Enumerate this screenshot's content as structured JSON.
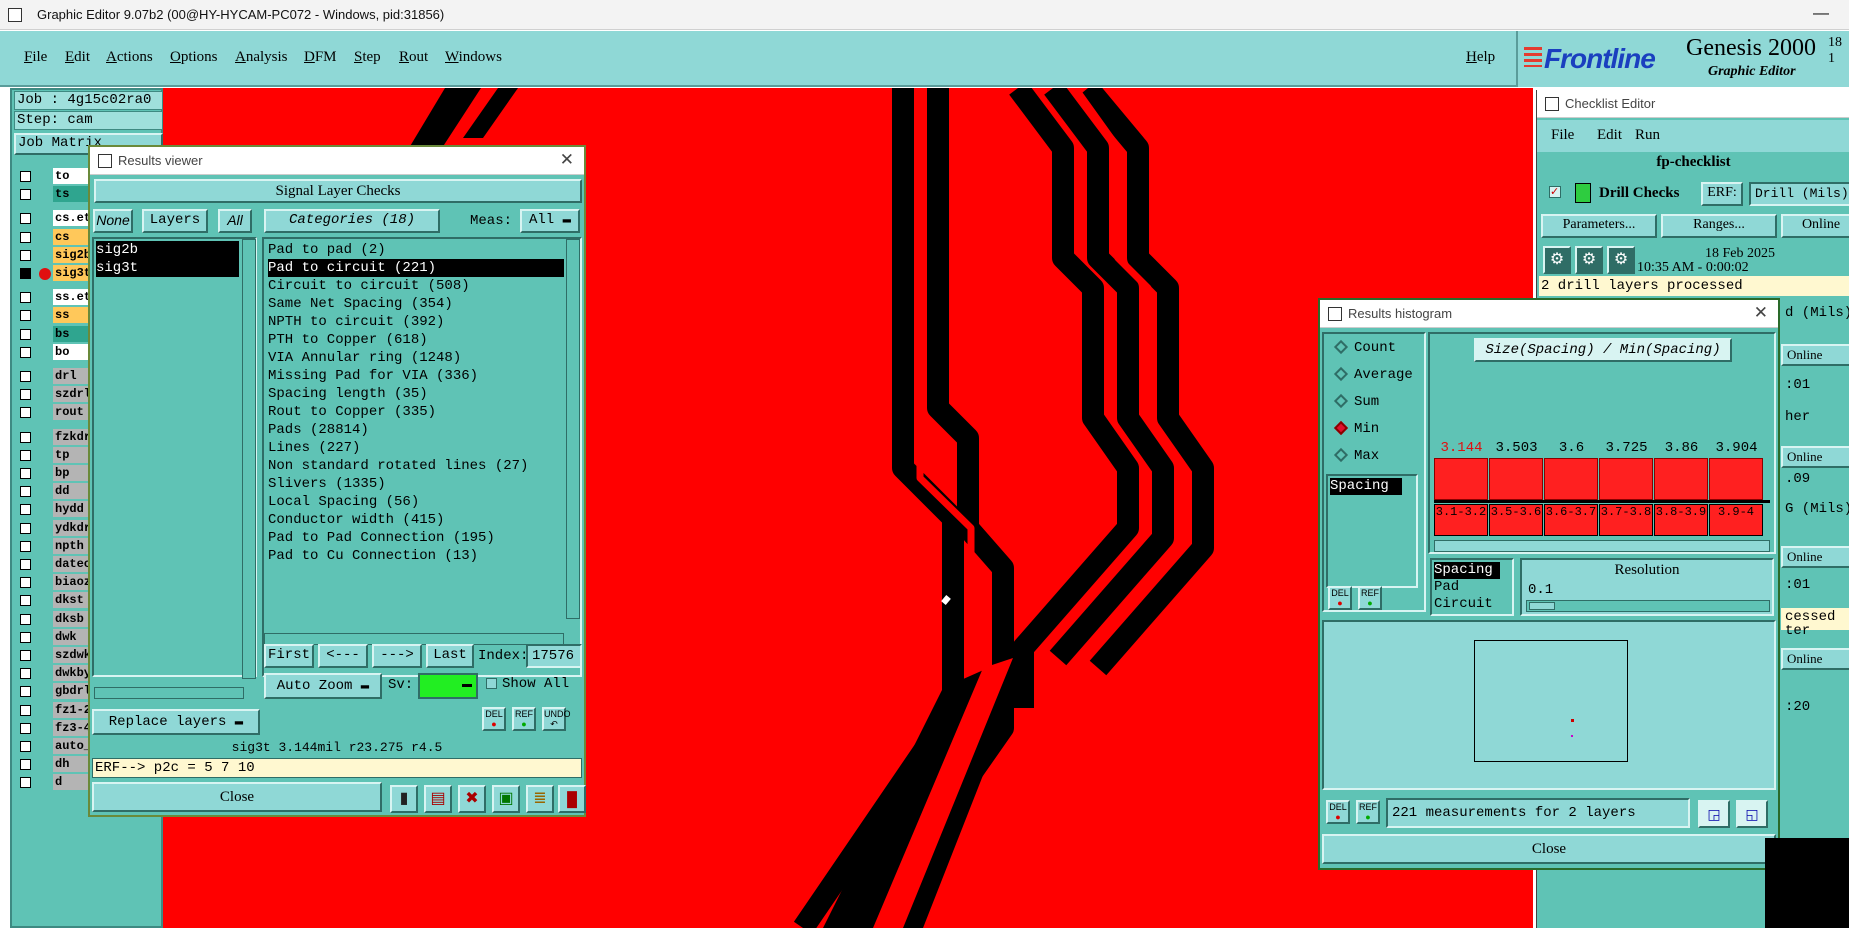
{
  "window": {
    "title": "Graphic Editor 9.07b2 (00@HY-HYCAM-PC072 - Windows, pid:31856)",
    "minimize": "—"
  },
  "menu": {
    "items": [
      "File",
      "Edit",
      "Actions",
      "Options",
      "Analysis",
      "DFM",
      "Step",
      "Rout",
      "Windows"
    ],
    "help": "Help"
  },
  "brand": {
    "logo": "Frontline",
    "product": "Genesis 2000",
    "sup": "18 1",
    "subtitle": "Graphic Editor"
  },
  "left_panel": {
    "job": "Job : 4g15c02ra0",
    "step": "Step: cam",
    "job_matrix": "Job Matrix",
    "layers": [
      {
        "name": "to",
        "color": "#ffffff"
      },
      {
        "name": "ts",
        "color": "#2fa58f"
      },
      {
        "name": "cs.etc",
        "color": "#ffffff"
      },
      {
        "name": "cs",
        "color": "#ffc85a"
      },
      {
        "name": "sig2b",
        "color": "#ffc85a"
      },
      {
        "name": "sig3t",
        "color": "#ffc85a"
      },
      {
        "name": "ss.etc",
        "color": "#ffffff"
      },
      {
        "name": "ss",
        "color": "#ffc85a"
      },
      {
        "name": "bs",
        "color": "#2fa58f"
      },
      {
        "name": "bo",
        "color": "#ffffff"
      },
      {
        "name": "drl",
        "color": "#b4b4b4"
      },
      {
        "name": "szdrl",
        "color": "#b4b4b4"
      },
      {
        "name": "rout",
        "color": "#b4b4b4"
      },
      {
        "name": "fzkdrl",
        "color": "#b4b4b4"
      },
      {
        "name": "tp",
        "color": "#b4b4b4"
      },
      {
        "name": "bp",
        "color": "#b4b4b4"
      },
      {
        "name": "dd",
        "color": "#b4b4b4"
      },
      {
        "name": "hydd",
        "color": "#b4b4b4"
      },
      {
        "name": "ydkdrl",
        "color": "#b4b4b4"
      },
      {
        "name": "npth",
        "color": "#b4b4b4"
      },
      {
        "name": "datecode",
        "color": "#b4b4b4"
      },
      {
        "name": "biaozhi",
        "color": "#b4b4b4"
      },
      {
        "name": "dkst",
        "color": "#b4b4b4"
      },
      {
        "name": "dksb",
        "color": "#b4b4b4"
      },
      {
        "name": "dwk",
        "color": "#b4b4b4"
      },
      {
        "name": "szdwk",
        "color": "#b4b4b4"
      },
      {
        "name": "dwkby",
        "color": "#b4b4b4"
      },
      {
        "name": "gbdrl",
        "color": "#b4b4b4"
      },
      {
        "name": "fz1-2",
        "color": "#b4b4b4"
      },
      {
        "name": "fz3-4",
        "color": "#b4b4b4"
      },
      {
        "name": "auto_",
        "color": "#b4b4b4"
      },
      {
        "name": "dh",
        "color": "#b4b4b4"
      },
      {
        "name": "d",
        "color": "#b4b4b4"
      }
    ]
  },
  "results_viewer": {
    "title": "Results viewer",
    "header": "Signal Layer Checks",
    "none_btn": "None",
    "layers_btn": "Layers",
    "all_btn": "All",
    "categories_btn": "Categories (18)",
    "meas_label": "Meas:",
    "meas_value": "All",
    "layers": [
      "sig2b",
      "sig3t"
    ],
    "categories": [
      "Pad to pad (2)",
      "Pad to circuit (221)",
      "Circuit to circuit (508)",
      "Same Net Spacing (354)",
      "NPTH to circuit (392)",
      "PTH to Copper (618)",
      "VIA Annular ring (1248)",
      "Missing Pad for VIA (336)",
      "Spacing length (35)",
      "Rout to Copper (335)",
      "Pads (28814)",
      "Lines (227)",
      "Non standard rotated lines (27)",
      "Slivers (1335)",
      "Local Spacing (56)",
      "Conductor width (415)",
      "Pad to Pad Connection (195)",
      "Pad to Cu Connection (13)"
    ],
    "selected_category": "Pad to circuit (221)",
    "first_btn": "First",
    "prev_btn": "<---",
    "next_btn": "--->",
    "last_btn": "Last",
    "index_label": "Index:",
    "index_value": "17576",
    "auto_zoom": "Auto Zoom",
    "sv_label": "Sv:",
    "show_all": "Show All",
    "replace_layers": "Replace layers",
    "del_btn": "DEL",
    "ref_btn": "REF",
    "undo_btn": "UNDO",
    "status": "sig3t 3.144mil  r23.275  r4.5",
    "erf": "ERF--> p2c = 5 7 10",
    "close": "Close"
  },
  "histogram": {
    "title": "Results histogram",
    "options": [
      "Count",
      "Average",
      "Sum",
      "Min",
      "Max"
    ],
    "selected_option": "Min",
    "measure_list": [
      "Spacing"
    ],
    "chart_title": "Size(Spacing) / Min(Spacing)",
    "bins": [
      {
        "label": "3.1-3.2",
        "value": "3.144",
        "highlight": true
      },
      {
        "label": "3.5-3.6",
        "value": "3.503",
        "highlight": false
      },
      {
        "label": "3.6-3.7",
        "value": "3.6",
        "highlight": false
      },
      {
        "label": "3.7-3.8",
        "value": "3.725",
        "highlight": false
      },
      {
        "label": "3.8-3.9",
        "value": "3.86",
        "highlight": false
      },
      {
        "label": "3.9-4",
        "value": "3.904",
        "highlight": false
      }
    ],
    "x_list": [
      "Spacing",
      "Pad",
      "Circuit"
    ],
    "resolution_label": "Resolution",
    "resolution_value": "0.1",
    "del_btn": "DEL",
    "ref_btn": "REF",
    "summary": "221 measurements for 2 layers",
    "close": "Close"
  },
  "checklist": {
    "title": "Checklist Editor",
    "menu": [
      "File",
      "Edit",
      "Run"
    ],
    "name": "fp-checklist",
    "check_name": "Drill Checks",
    "erf_label": "ERF:",
    "erf_value": "Drill (Mils)",
    "parameters_btn": "Parameters...",
    "ranges_btn": "Ranges...",
    "online_btn": "Online",
    "date": "18 Feb 2025",
    "time": "10:35 AM - 0:00:02",
    "status": "2 drill layers processed",
    "partial_rows": [
      "d (Mils)",
      "Online",
      ":01",
      "her",
      "Online",
      ".09",
      "G (Mils)",
      "Online",
      ":01",
      "cessed",
      "ter",
      "Online",
      ":20"
    ]
  }
}
